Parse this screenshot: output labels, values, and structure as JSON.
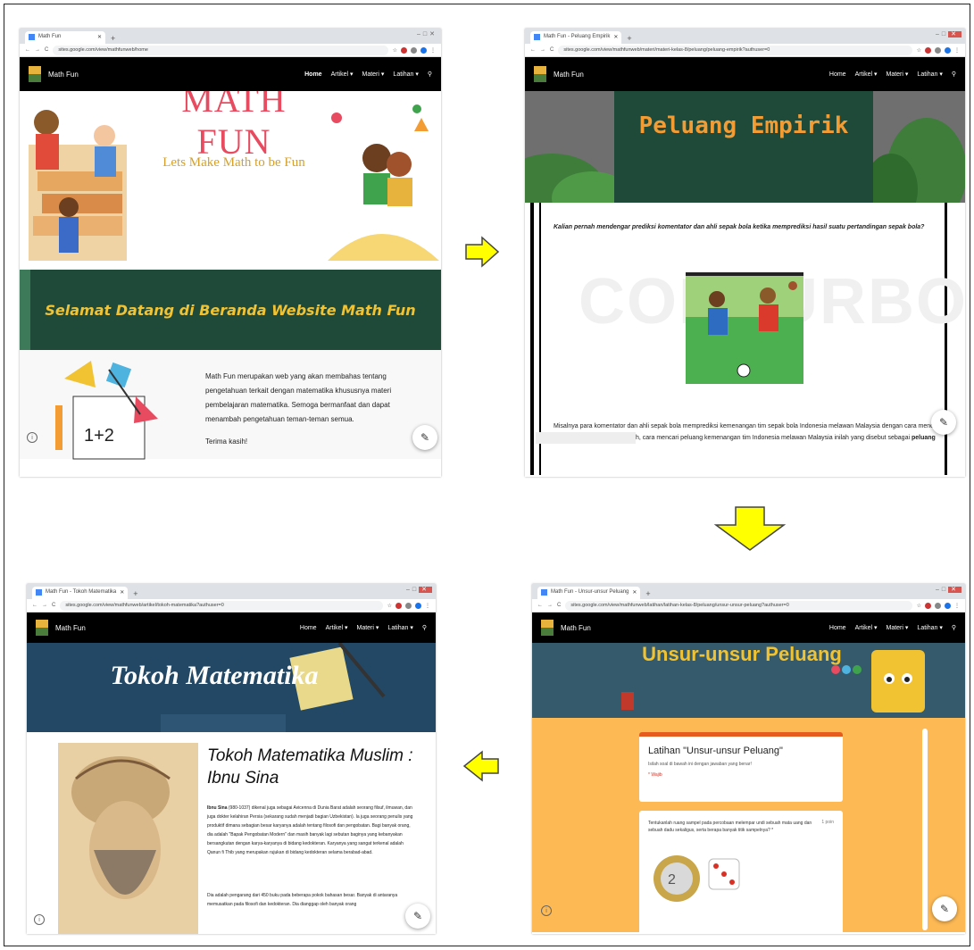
{
  "screens": {
    "home": {
      "tab_title": "Math Fun",
      "url": "sites.google.com/view/mathfunweb/home",
      "site_name": "Math Fun",
      "nav": [
        "Home",
        "Artikel ▾",
        "Materi ▾",
        "Latihan ▾"
      ],
      "hero_title": "MATH FUN",
      "hero_subtitle": "Lets Make Math to be Fun",
      "welcome_banner": "Selamat Datang di Beranda Website Math Fun",
      "intro_text": "Math Fun merupakan web yang akan membahas tentang pengetahuan terkait dengan matematika khususnya materi pembelajaran matematika. Semoga bermanfaat dan dapat menambah pengetahuan teman-teman semua.",
      "closing": "Terima kasih!"
    },
    "peluang": {
      "tab_title": "Math Fun - Peluang Empirik",
      "url": "sites.google.com/view/mathfunweb/materi/materi-kelas-8/peluang/peluang-empirik?authuser=0",
      "site_name": "Math Fun",
      "nav": [
        "Home",
        "Artikel ▾",
        "Materi ▾",
        "Latihan ▾"
      ],
      "banner_title": "Peluang Empirik",
      "question": "Kalian pernah mendengar prediksi komentator dan ahli sepak bola ketika memprediksi hasil suatu pertandingan sepak bola?",
      "watermark": "COLOURBOX",
      "body_line1": "Misalnya para komentator dan ahli sepak bola memprediksi kemenangan tim sepak bola Indonesia melawan Malaysia dengan cara mencari",
      "body_line2": "h, cara mencari peluang kemenangan tim Indonesia melawan Malaysia inilah yang disebut sebagai",
      "body_bold": "peluang"
    },
    "latihan": {
      "tab_title": "Math Fun - Unsur-unsur Peluang",
      "url": "sites.google.com/view/mathfunweb/latihan/latihan-kelas-8/peluang/unsur-unsur-peluang?authuser=0",
      "site_name": "Math Fun",
      "nav": [
        "Home",
        "Artikel ▾",
        "Materi ▾",
        "Latihan ▾"
      ],
      "banner_title": "Unsur-unsur Peluang",
      "form_title": "Latihan \"Unsur-unsur Peluang\"",
      "form_desc": "Isilah soal di bawah ini dengan jawaban yang benar!",
      "required_note": "* Wajib",
      "q_text": "Tentukanlah ruang sampel pada percobaan melempar undi sebuah mata uang dan sebuah dadu sekaligus, serta berapa banyak titik sampelnya? *",
      "q_points": "1 poin"
    },
    "tokoh": {
      "tab_title": "Math Fun - Tokoh Matematika",
      "url": "sites.google.com/view/mathfunweb/artikel/tokoh-matematika?authuser=0",
      "site_name": "Math Fun",
      "nav": [
        "Home",
        "Artikel ▾",
        "Materi ▾",
        "Latihan ▾"
      ],
      "banner_title": "Tokoh Matematika",
      "article_title": "Tokoh Matematika Muslim : Ibnu Sina",
      "p1_bold": "Ibnu Sina",
      "p1_rest": " (980-1037) dikenal juga sebagai Avicenna di Dunia Barat adalah seorang filsuf, ilmuwan, dan juga dokter kelahiran Persia (sekarang sudah menjadi bagian Uzbekistan). Ia juga seorang penulis yang produktif dimana sebagian besar karyanya adalah tentang filosofi dan pengobatan. Bagi banyak orang, dia adalah \"Bapak Pengobatan Modern\" dan masih banyak lagi sebutan baginya yang kebanyakan bersangkutan dengan karya-karyanya di bidang kedokteran. Karyanya yang sangat terkenal adalah Qanun fi Thib yang merupakan rujukan di bidang kedokteran selama berabad-abad.",
      "p2": "Dia adalah pengarang dari 450 buku pada beberapa pokok bahasan besar. Banyak di antaranya memusatkan pada filosofi dan kedokteran. Dia dianggap oleh banyak orang"
    }
  },
  "colors": {
    "nav_bg": "#000000",
    "chalkboard": "#1f4a3a",
    "banner_gold": "#f1c232",
    "peluang_orange": "#f39c33",
    "form_bg": "#fdb954",
    "tokoh_blue": "#1d3a55",
    "arrow_fill": "#ffff00"
  }
}
